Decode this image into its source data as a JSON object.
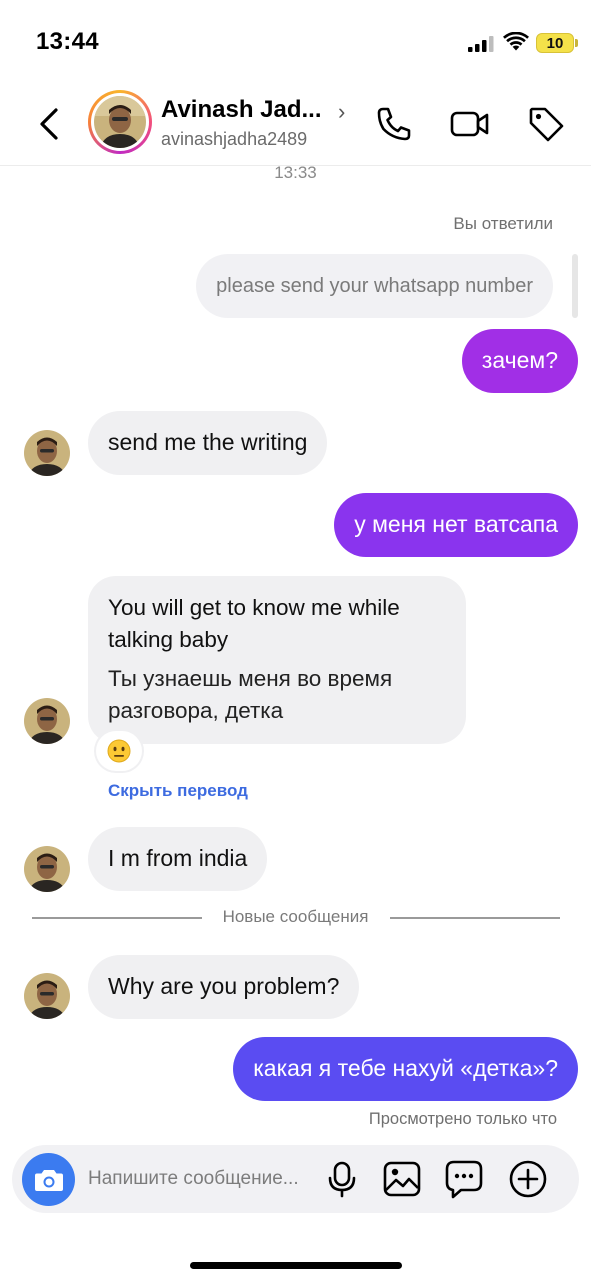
{
  "status_bar": {
    "time": "13:44",
    "battery": "10"
  },
  "header": {
    "name": "Avinash Jad...",
    "chevron": "›",
    "handle": "avinashjadha2489",
    "icons": [
      "back-icon",
      "phone-icon",
      "video-icon",
      "tag-icon"
    ]
  },
  "thread": {
    "timestamp": "13:33",
    "reply_note": "Вы ответили",
    "replied_to": "please send your whatsapp number",
    "messages": [
      {
        "from": "me",
        "text": "зачем?"
      },
      {
        "from": "them",
        "text": "send me the writing"
      },
      {
        "from": "me",
        "text": "у меня нет ватсапа"
      },
      {
        "from": "them",
        "original": "You will get to know me while talking baby",
        "translation": "Ты узнаешь меня во время разговора, детка",
        "reaction": "😐",
        "hide_translation": "Скрыть перевод"
      },
      {
        "from": "them",
        "text": "I m from india"
      },
      {
        "from": "them",
        "text": "Why are you problem?"
      },
      {
        "from": "me",
        "text": "какая я тебе нахуй «детка»?"
      }
    ],
    "new_messages_divider": "Новые сообщения",
    "seen_status": "Просмотрено только что"
  },
  "composer": {
    "placeholder": "Напишите сообщение...",
    "icons": [
      "camera-icon",
      "microphone-icon",
      "gallery-icon",
      "sticker-icon",
      "add-icon"
    ]
  },
  "colors": {
    "accent_purple": "#a12fe6",
    "accent_violet": "#7a3ff0",
    "accent_blue": "#5a4cf2",
    "camera_blue": "#3b7bf0",
    "link_blue": "#3d6be0"
  }
}
